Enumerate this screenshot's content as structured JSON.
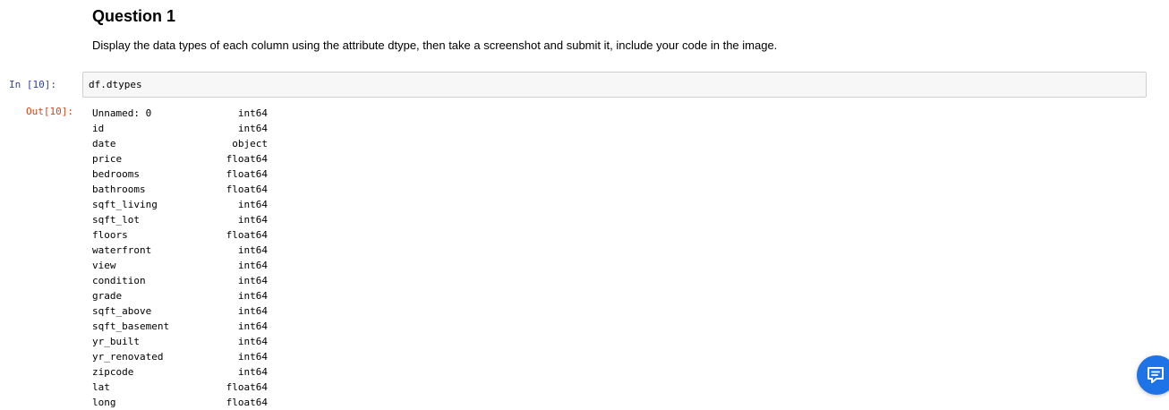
{
  "markdown": {
    "heading": "Question 1",
    "paragraph": "Display the data types of each column using the attribute dtype, then take a screenshot and submit it, include your code in the image."
  },
  "code_cell": {
    "in_prompt": "In [10]:",
    "code": "df.dtypes",
    "out_prompt": "Out[10]:"
  },
  "output": {
    "rows": [
      {
        "name": "Unnamed: 0",
        "type": "int64"
      },
      {
        "name": "id",
        "type": "int64"
      },
      {
        "name": "date",
        "type": "object"
      },
      {
        "name": "price",
        "type": "float64"
      },
      {
        "name": "bedrooms",
        "type": "float64"
      },
      {
        "name": "bathrooms",
        "type": "float64"
      },
      {
        "name": "sqft_living",
        "type": "int64"
      },
      {
        "name": "sqft_lot",
        "type": "int64"
      },
      {
        "name": "floors",
        "type": "float64"
      },
      {
        "name": "waterfront",
        "type": "int64"
      },
      {
        "name": "view",
        "type": "int64"
      },
      {
        "name": "condition",
        "type": "int64"
      },
      {
        "name": "grade",
        "type": "int64"
      },
      {
        "name": "sqft_above",
        "type": "int64"
      },
      {
        "name": "sqft_basement",
        "type": "int64"
      },
      {
        "name": "yr_built",
        "type": "int64"
      },
      {
        "name": "yr_renovated",
        "type": "int64"
      },
      {
        "name": "zipcode",
        "type": "int64"
      },
      {
        "name": "lat",
        "type": "float64"
      },
      {
        "name": "long",
        "type": "float64"
      }
    ]
  },
  "colors": {
    "in_prompt": "#303f9f",
    "out_prompt": "#d84315",
    "feedback_button": "#1e74e6"
  },
  "icons": {
    "feedback": "chat-feedback-icon"
  }
}
